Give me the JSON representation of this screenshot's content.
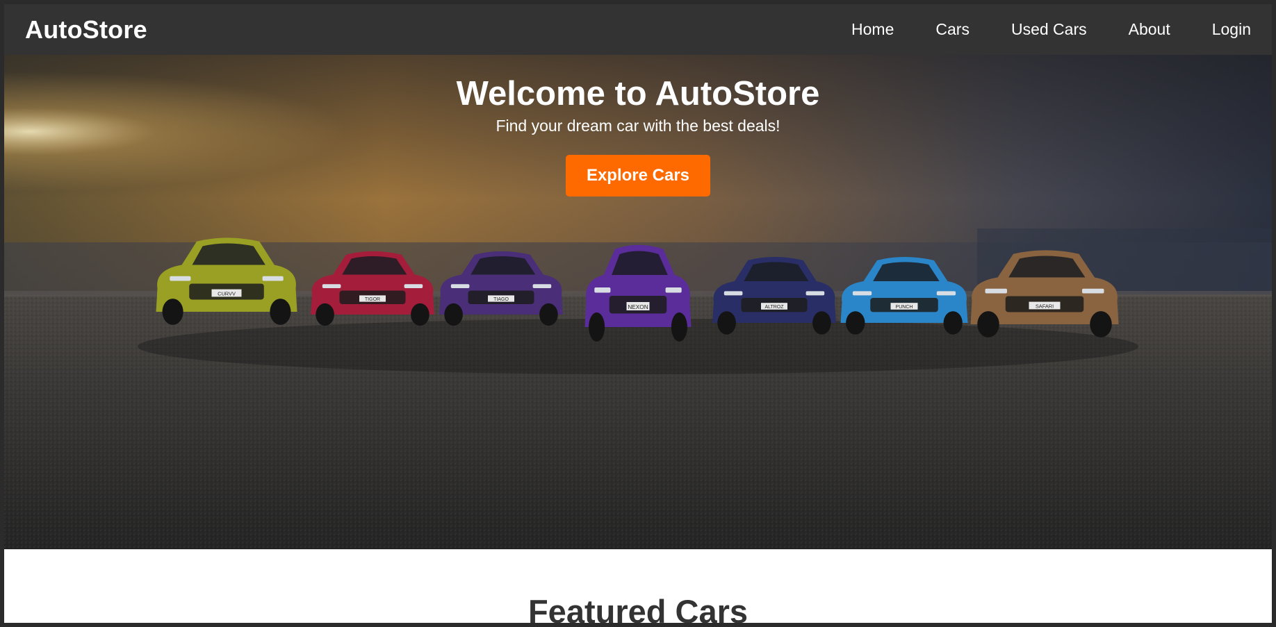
{
  "navbar": {
    "brand": "AutoStore",
    "links": [
      {
        "label": "Home"
      },
      {
        "label": "Cars"
      },
      {
        "label": "Used Cars"
      },
      {
        "label": "About"
      },
      {
        "label": "Login"
      }
    ]
  },
  "hero": {
    "title": "Welcome to AutoStore",
    "subtitle": "Find your dream car with the best deals!",
    "cta_label": "Explore Cars"
  },
  "featured": {
    "title": "Featured Cars"
  },
  "colors": {
    "navbar_bg": "#333333",
    "accent": "#ff6a00",
    "featured_title": "#333333"
  },
  "hero_cars": [
    {
      "color": "#9aa024",
      "badge": "CURVV"
    },
    {
      "color": "#a41e3c",
      "badge": "TIGOR"
    },
    {
      "color": "#4a2e78",
      "badge": "TIAGO"
    },
    {
      "color": "#5b2d9a",
      "badge": "NEXON"
    },
    {
      "color": "#2a2e66",
      "badge": "ALTROZ"
    },
    {
      "color": "#2a86c8",
      "badge": "PUNCH"
    },
    {
      "color": "#8a6440",
      "badge": "SAFARI"
    }
  ]
}
